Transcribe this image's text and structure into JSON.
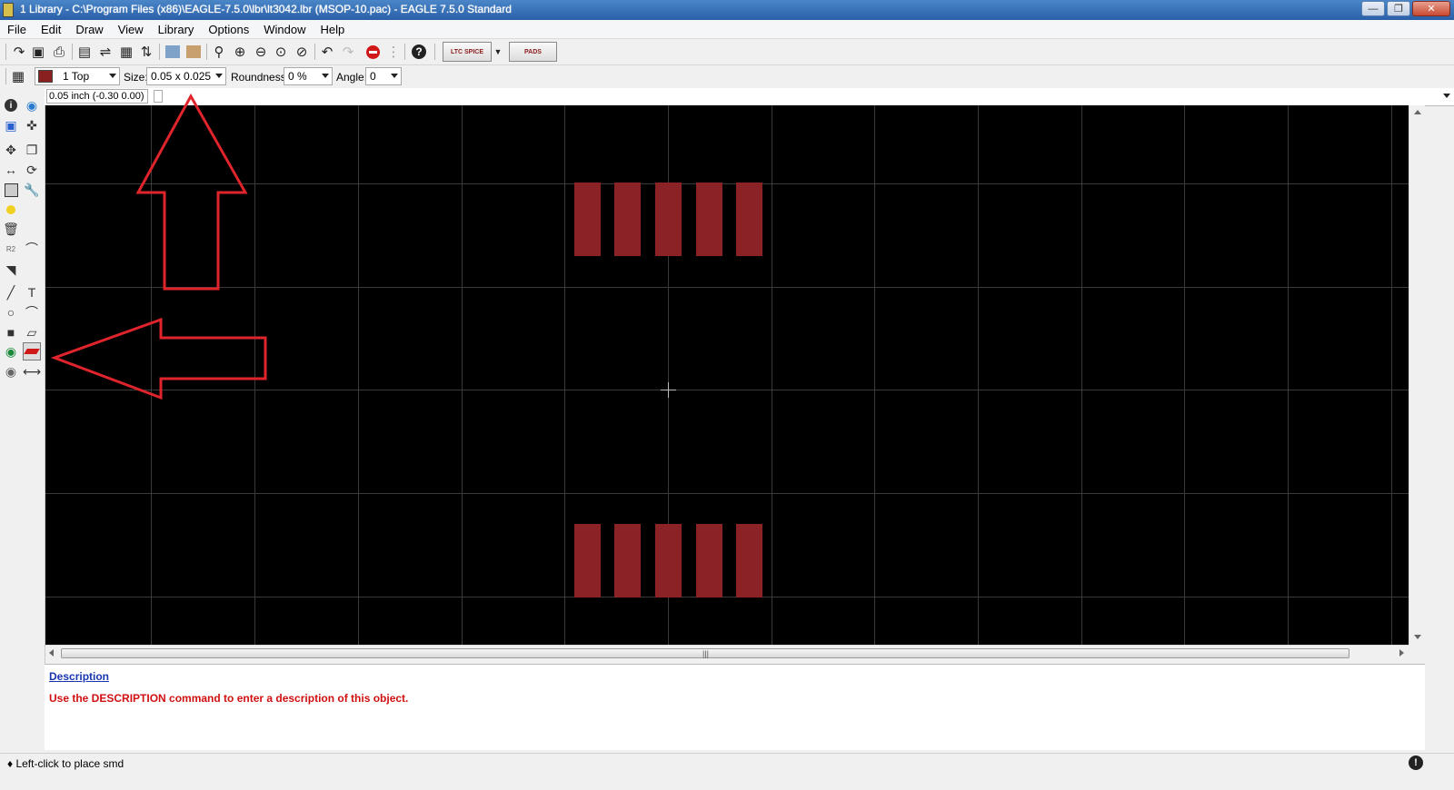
{
  "window": {
    "title": "1 Library - C:\\Program Files (x86)\\EAGLE-7.5.0\\lbr\\lt3042.lbr (MSOP-10.pac) - EAGLE 7.5.0 Standard"
  },
  "menu": {
    "items": [
      "File",
      "Edit",
      "Draw",
      "View",
      "Library",
      "Options",
      "Window",
      "Help"
    ]
  },
  "toolbar": {
    "ltspice_label": "LTC SPICE",
    "pads_label": "PADS"
  },
  "parambar": {
    "layer": "1 Top",
    "layer_color": "#8b2020",
    "size_label": "Size:",
    "size_value": "0.05 x 0.025",
    "roundness_label": "Roundness:",
    "roundness_value": "0 %",
    "angle_label": "Angle:",
    "angle_value": "0"
  },
  "cmdline": {
    "coordinates": "0.05 inch (-0.30 0.00)",
    "value": ""
  },
  "description": {
    "heading": "Description",
    "text": "Use the DESCRIPTION command to enter a description of this object."
  },
  "status": {
    "text": "♦ Left-click to place smd"
  },
  "colors": {
    "pad": "#8b2226",
    "canvas": "#000000",
    "annotation": "#e0242c"
  }
}
